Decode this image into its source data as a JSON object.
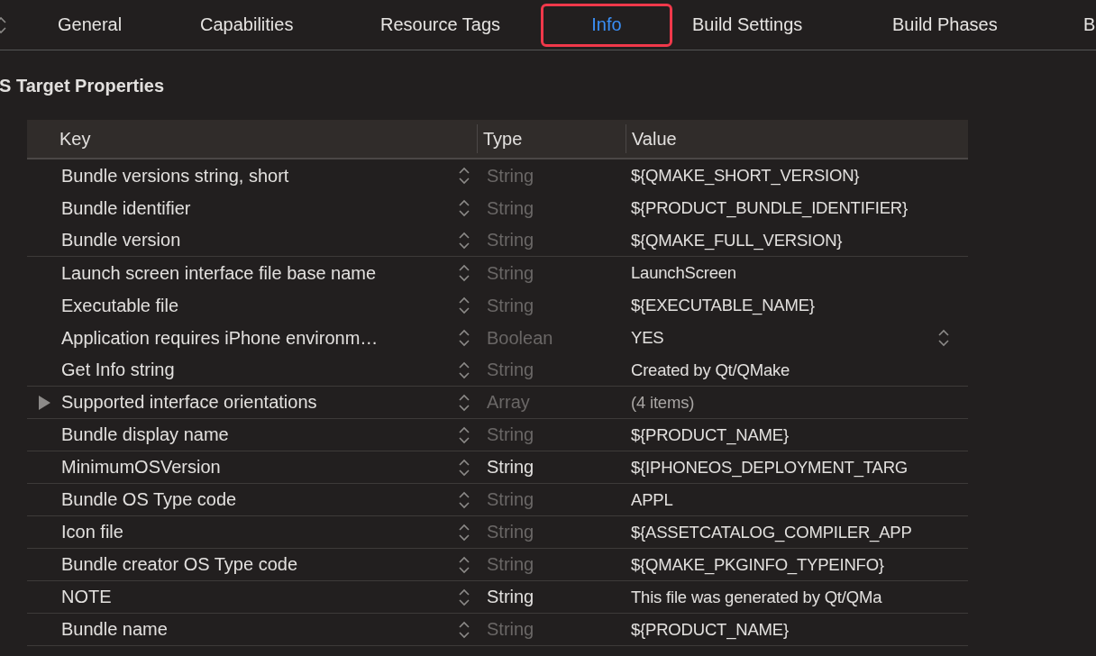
{
  "tabs": [
    {
      "label": "General",
      "selected": false
    },
    {
      "label": "Capabilities",
      "selected": false
    },
    {
      "label": "Resource Tags",
      "selected": false
    },
    {
      "label": "Info",
      "selected": true
    },
    {
      "label": "Build Settings",
      "selected": false
    },
    {
      "label": "Build Phases",
      "selected": false
    },
    {
      "label": "B",
      "selected": false
    }
  ],
  "section_title": "S Target Properties",
  "table": {
    "columns": [
      "Key",
      "Type",
      "Value"
    ],
    "rows": [
      {
        "key": "Bundle versions string, short",
        "type": "String",
        "value": "${QMAKE_SHORT_VERSION}",
        "kind": "string",
        "dimmed": true,
        "divider": false
      },
      {
        "key": "Bundle identifier",
        "type": "String",
        "value": "${PRODUCT_BUNDLE_IDENTIFIER}",
        "kind": "string",
        "dimmed": true,
        "divider": false
      },
      {
        "key": "Bundle version",
        "type": "String",
        "value": "${QMAKE_FULL_VERSION}",
        "kind": "string",
        "dimmed": true,
        "divider": true
      },
      {
        "key": "Launch screen interface file base name",
        "type": "String",
        "value": "LaunchScreen",
        "kind": "string",
        "dimmed": true,
        "divider": false
      },
      {
        "key": "Executable file",
        "type": "String",
        "value": "${EXECUTABLE_NAME}",
        "kind": "string",
        "dimmed": true,
        "divider": false
      },
      {
        "key": "Application requires iPhone environm…",
        "type": "Boolean",
        "value": "YES",
        "kind": "boolean",
        "dimmed": true,
        "divider": false
      },
      {
        "key": "Get Info string",
        "type": "String",
        "value": "Created by Qt/QMake",
        "kind": "string",
        "dimmed": true,
        "divider": true
      },
      {
        "key": "Supported interface orientations",
        "type": "Array",
        "value": "(4 items)",
        "kind": "array",
        "expanded": false,
        "dimmed": true,
        "divider": true
      },
      {
        "key": "Bundle display name",
        "type": "String",
        "value": "${PRODUCT_NAME}",
        "kind": "string",
        "dimmed": true,
        "divider": true
      },
      {
        "key": "MinimumOSVersion",
        "type": "String",
        "value": "${IPHONEOS_DEPLOYMENT_TARG",
        "kind": "string",
        "dimmed": false,
        "divider": true
      },
      {
        "key": "Bundle OS Type code",
        "type": "String",
        "value": "APPL",
        "kind": "string",
        "dimmed": true,
        "divider": true
      },
      {
        "key": "Icon file",
        "type": "String",
        "value": "${ASSETCATALOG_COMPILER_APP",
        "kind": "string",
        "dimmed": true,
        "divider": true
      },
      {
        "key": "Bundle creator OS Type code",
        "type": "String",
        "value": "${QMAKE_PKGINFO_TYPEINFO}",
        "kind": "string",
        "dimmed": true,
        "divider": true
      },
      {
        "key": "NOTE",
        "type": "String",
        "value": "This file was generated by Qt/QMa",
        "kind": "string",
        "dimmed": false,
        "divider": true
      },
      {
        "key": "Bundle name",
        "type": "String",
        "value": "${PRODUCT_NAME}",
        "kind": "string",
        "dimmed": true,
        "divider": true
      }
    ]
  }
}
